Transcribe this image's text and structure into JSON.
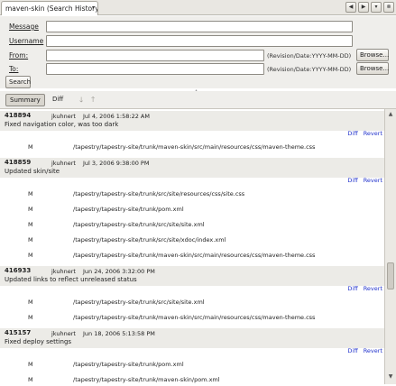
{
  "tab": {
    "title": "maven-skin (Search History)",
    "dropdown_icon": "chevron-down-icon"
  },
  "tab_controls": [
    "back-icon",
    "forward-icon",
    "menu-icon",
    "close-icon"
  ],
  "form": {
    "message_label": "Message",
    "message_value": "",
    "username_label": "Username",
    "username_value": "",
    "from_label": "From:",
    "from_value": "",
    "from_hint": "(Revision/Date:YYYY-MM-DD)",
    "from_browse": "Browse...",
    "to_label": "To:",
    "to_value": "",
    "to_hint": "(Revision/Date:YYYY-MM-DD)",
    "to_browse": "Browse...",
    "search_button": "Search"
  },
  "toolbar": {
    "summary_label": "Summary",
    "diff_label": "Diff"
  },
  "entries": [
    {
      "revision": "418894",
      "author": "jkuhnert",
      "date": "Jul 4, 2006 1:58:22 AM",
      "message": "Fixed navigation color, was too dark",
      "diff_link": "Diff",
      "revert_link": "Revert",
      "files": [
        {
          "action": "M",
          "path": "/tapestry/tapestry-site/trunk/maven-skin/src/main/resources/css/maven-theme.css"
        }
      ]
    },
    {
      "revision": "418859",
      "author": "jkuhnert",
      "date": "Jul 3, 2006 9:38:00 PM",
      "message": "Updated skin/site",
      "diff_link": "Diff",
      "revert_link": "Revert",
      "files": [
        {
          "action": "M",
          "path": "/tapestry/tapestry-site/trunk/src/site/resources/css/site.css"
        },
        {
          "action": "M",
          "path": "/tapestry/tapestry-site/trunk/pom.xml"
        },
        {
          "action": "M",
          "path": "/tapestry/tapestry-site/trunk/src/site/site.xml"
        },
        {
          "action": "M",
          "path": "/tapestry/tapestry-site/trunk/src/site/xdoc/index.xml"
        },
        {
          "action": "M",
          "path": "/tapestry/tapestry-site/trunk/maven-skin/src/main/resources/css/maven-theme.css"
        }
      ]
    },
    {
      "revision": "416933",
      "author": "jkuhnert",
      "date": "Jun 24, 2006 3:32:00 PM",
      "message": "Updated links to reflect unreleased status",
      "diff_link": "Diff",
      "revert_link": "Revert",
      "files": [
        {
          "action": "M",
          "path": "/tapestry/tapestry-site/trunk/src/site/site.xml"
        },
        {
          "action": "M",
          "path": "/tapestry/tapestry-site/trunk/maven-skin/src/main/resources/css/maven-theme.css"
        }
      ]
    },
    {
      "revision": "415157",
      "author": "jkuhnert",
      "date": "Jun 18, 2006 5:13:58 PM",
      "message": "Fixed deploy settings",
      "diff_link": "Diff",
      "revert_link": "Revert",
      "files": [
        {
          "action": "M",
          "path": "/tapestry/tapestry-site/trunk/pom.xml"
        },
        {
          "action": "M",
          "path": "/tapestry/tapestry-site/trunk/maven-skin/pom.xml"
        }
      ]
    }
  ],
  "colors": {
    "link": "#2233cc",
    "header_bg": "#ecebe7",
    "panel_bg": "#efeeeb"
  }
}
